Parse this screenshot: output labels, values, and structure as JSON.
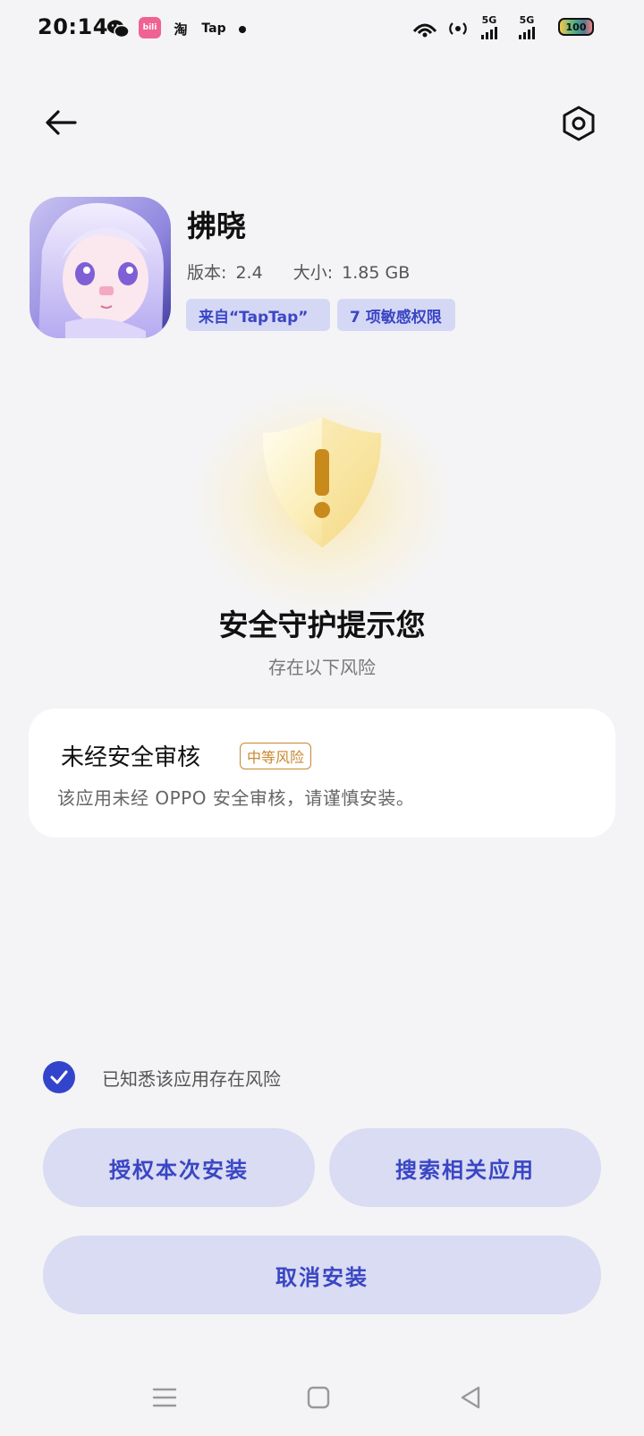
{
  "status_bar": {
    "time": "20:14",
    "notification_icons": [
      "wechat-icon",
      "bilibili-icon",
      "taobao-icon",
      "taptap-icon",
      "dot-icon"
    ],
    "taobao_label": "淘",
    "tap_label": "Tap",
    "bili_label": "bili",
    "signal_label": "5G",
    "battery_label": "100"
  },
  "header": {
    "back_icon": "arrow-left-icon",
    "settings_icon": "gear-hex-icon"
  },
  "app": {
    "name": "拂晓",
    "version_label": "版本:",
    "version": "2.4",
    "size_label": "大小:",
    "size": "1.85 GB",
    "source_tag": "来自“TapTap”",
    "permissions_tag": "7 项敏感权限"
  },
  "warning": {
    "shield_symbol": "!",
    "headline": "安全守护提示您",
    "subline": "存在以下风险"
  },
  "risk_card": {
    "title": "未经安全审核",
    "level_badge": "中等风险",
    "description": "该应用未经 OPPO 安全审核，请谨慎安装。"
  },
  "acknowledge": {
    "checked": true,
    "label": "已知悉该应用存在风险"
  },
  "actions": {
    "authorize": "授权本次安装",
    "search": "搜索相关应用",
    "cancel": "取消安装"
  },
  "colors": {
    "accent": "#3344cc",
    "button_bg": "#d9dcf2",
    "badge": "#c8872f",
    "background": "#f4f4f6"
  }
}
